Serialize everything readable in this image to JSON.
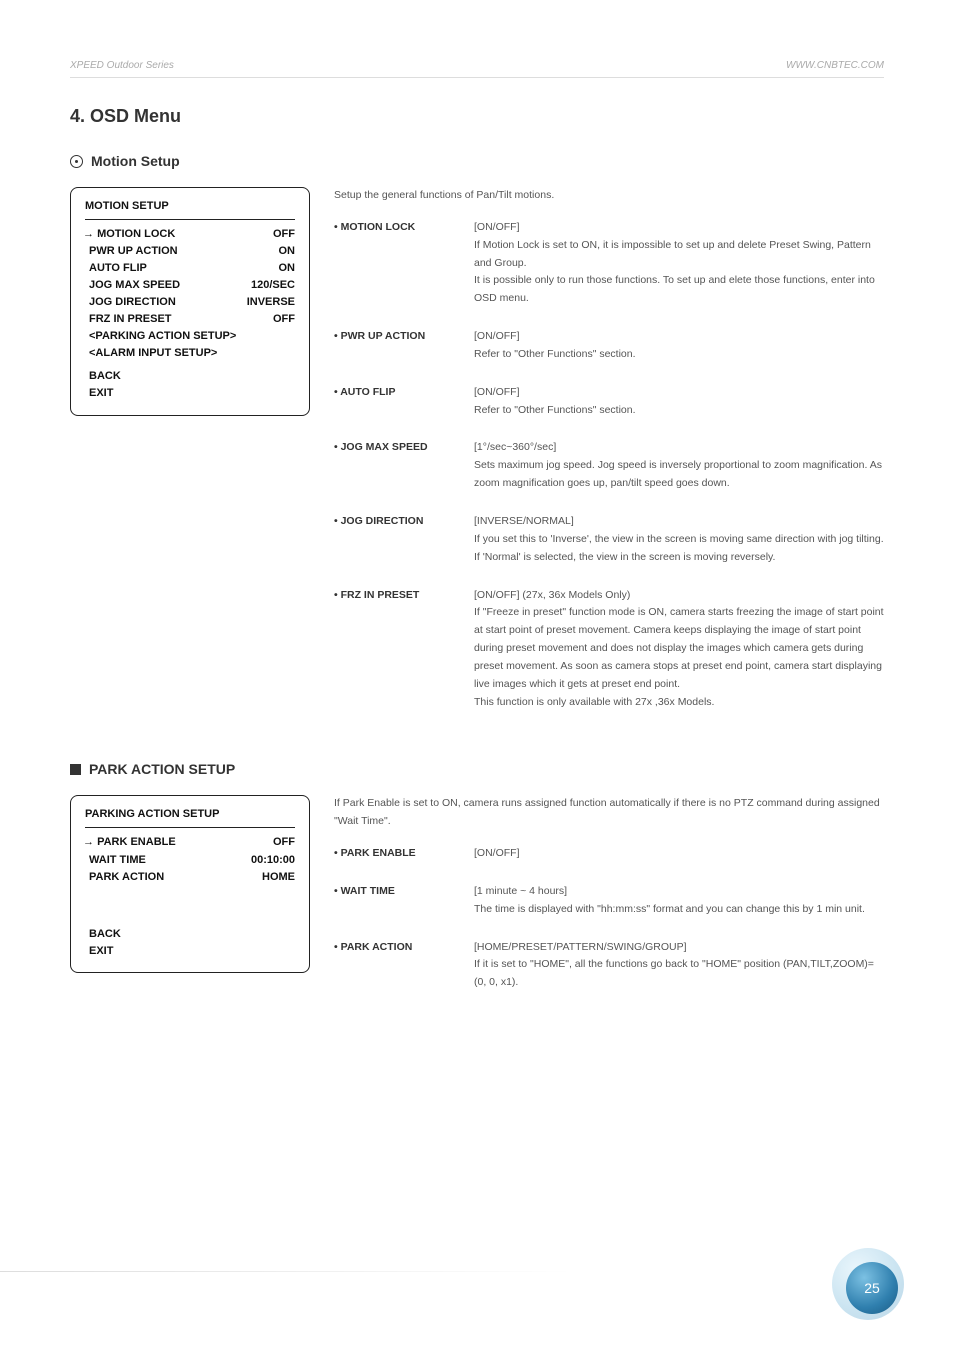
{
  "header": {
    "left": "XPEED Outdoor Series",
    "right": "WWW.CNBTEC.COM"
  },
  "title": "4. OSD Menu",
  "motion": {
    "heading": "Motion Setup",
    "osd": {
      "title": "MOTION SETUP",
      "items": [
        {
          "label": "MOTION LOCK",
          "val": "OFF",
          "arrow": true
        },
        {
          "label": "PWR UP ACTION",
          "val": "ON"
        },
        {
          "label": "AUTO FLIP",
          "val": "ON"
        },
        {
          "label": "JOG MAX SPEED",
          "val": "120/SEC"
        },
        {
          "label": "JOG DIRECTION",
          "val": "INVERSE"
        },
        {
          "label": "FRZ IN PRESET",
          "val": "OFF"
        },
        {
          "label": "<PARKING ACTION SETUP>",
          "val": ""
        },
        {
          "label": "<ALARM INPUT SETUP>",
          "val": ""
        }
      ],
      "footer": [
        "BACK",
        "EXIT"
      ]
    },
    "intro": "Setup the general functions of Pan/Tilt motions.",
    "params": [
      {
        "name": "MOTION LOCK",
        "desc": "[ON/OFF]\nIf Motion Lock is set to ON, it is impossible to set up and delete Preset Swing, Pattern and Group.\nIt is possible only to run those functions. To set up and elete those functions, enter into OSD menu."
      },
      {
        "name": "PWR UP ACTION",
        "desc": "[ON/OFF]\nRefer to \"Other Functions\" section."
      },
      {
        "name": "AUTO FLIP",
        "desc": "[ON/OFF]\nRefer to \"Other Functions\" section."
      },
      {
        "name": "JOG MAX SPEED",
        "desc": "[1°/sec~360°/sec]\nSets maximum jog speed. Jog speed is inversely proportional to zoom magnification. As zoom magnification goes up, pan/tilt speed goes down."
      },
      {
        "name": "JOG DIRECTION",
        "desc": "[INVERSE/NORMAL]\nIf you set this to 'Inverse', the view in the screen is moving same direction with jog tilting. If 'Normal' is selected, the view in the screen is moving reversely."
      },
      {
        "name": "FRZ IN PRESET",
        "desc": "[ON/OFF] (27x, 36x Models Only)\nIf \"Freeze in preset\" function mode is ON, camera starts freezing the image of start point at start point of preset movement. Camera keeps displaying the image of start point during preset movement and does not display the images which camera gets during preset movement. As soon as camera stops at preset end point, camera start displaying live images which it gets at preset end point.\nThis function is only available with 27x ,36x Models."
      }
    ]
  },
  "park": {
    "heading": "PARK ACTION SETUP",
    "osd": {
      "title": "PARKING ACTION SETUP",
      "items": [
        {
          "label": "PARK ENABLE",
          "val": "OFF",
          "arrow": true
        },
        {
          "label": "WAIT TIME",
          "val": "00:10:00"
        },
        {
          "label": "PARK ACTION",
          "val": "HOME"
        }
      ],
      "footer": [
        "BACK",
        "EXIT"
      ]
    },
    "intro": "If Park Enable is set to ON, camera runs assigned function automatically if there is no PTZ command during assigned \"Wait Time\".",
    "params": [
      {
        "name": "PARK ENABLE",
        "desc": "[ON/OFF]"
      },
      {
        "name": "WAIT TIME",
        "desc": "[1 minute ~ 4 hours]\nThe time is displayed with \"hh:mm:ss\" format and you can change this by 1 min unit."
      },
      {
        "name": "PARK ACTION",
        "desc": "[HOME/PRESET/PATTERN/SWING/GROUP]\nIf it is set to \"HOME\", all the functions go back to \"HOME\" position (PAN,TILT,ZOOM)=(0, 0, x1)."
      }
    ]
  },
  "pageNumber": "25"
}
